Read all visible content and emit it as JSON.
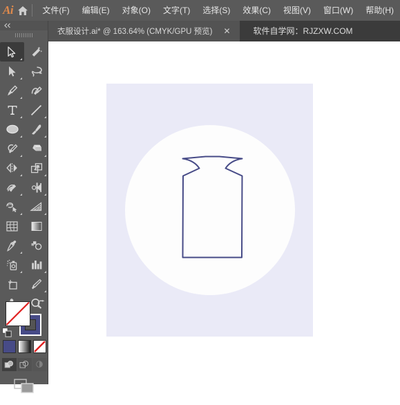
{
  "app": {
    "name": "Adobe Illustrator",
    "logo_text": "Ai",
    "logo_color": "#e08a4c",
    "home_icon": "home-icon"
  },
  "menubar": {
    "items": [
      {
        "label": "文件(F)",
        "name": "menu-file"
      },
      {
        "label": "编辑(E)",
        "name": "menu-edit"
      },
      {
        "label": "对象(O)",
        "name": "menu-object"
      },
      {
        "label": "文字(T)",
        "name": "menu-type"
      },
      {
        "label": "选择(S)",
        "name": "menu-select"
      },
      {
        "label": "效果(C)",
        "name": "menu-effect"
      },
      {
        "label": "视图(V)",
        "name": "menu-view"
      },
      {
        "label": "窗口(W)",
        "name": "menu-window"
      },
      {
        "label": "帮助(H)",
        "name": "menu-help"
      }
    ]
  },
  "tabbar": {
    "document_tab": {
      "label": "衣服设计.ai* @ 163.64% (CMYK/GPU 预览)",
      "filename": "衣服设计.ai",
      "modified": true,
      "zoom": "163.64%",
      "color_mode": "CMYK",
      "preview_mode": "GPU 预览",
      "close_icon": "close-icon",
      "close_label": "✕"
    },
    "promo_text": "软件自学网：RJZXW.COM"
  },
  "toolbar": {
    "collapse_label": "◂◂",
    "tools": [
      {
        "name": "selection-tool",
        "label": "选择工具",
        "active": true,
        "flyout": true
      },
      {
        "name": "magic-wand-tool",
        "label": "魔棒工具",
        "active": false,
        "flyout": false
      },
      {
        "name": "direct-selection-tool",
        "label": "直接选择工具",
        "active": false,
        "flyout": true
      },
      {
        "name": "lasso-tool",
        "label": "套索工具",
        "active": false,
        "flyout": false
      },
      {
        "name": "pen-tool",
        "label": "钢笔工具",
        "active": false,
        "flyout": true
      },
      {
        "name": "curvature-tool",
        "label": "曲率工具",
        "active": false,
        "flyout": false
      },
      {
        "name": "type-tool",
        "label": "文字工具",
        "active": false,
        "flyout": true
      },
      {
        "name": "line-segment-tool",
        "label": "直线段工具",
        "active": false,
        "flyout": true
      },
      {
        "name": "ellipse-tool",
        "label": "椭圆工具",
        "active": false,
        "flyout": true
      },
      {
        "name": "paintbrush-tool",
        "label": "画笔工具",
        "active": false,
        "flyout": true
      },
      {
        "name": "shaper-tool",
        "label": "Shaper 工具",
        "active": false,
        "flyout": true
      },
      {
        "name": "eraser-tool",
        "label": "橡皮擦工具",
        "active": false,
        "flyout": true
      },
      {
        "name": "reflect-tool",
        "label": "镜像工具",
        "active": false,
        "flyout": true
      },
      {
        "name": "scale-tool",
        "label": "比例缩放工具",
        "active": false,
        "flyout": true
      },
      {
        "name": "width-tool",
        "label": "宽度工具",
        "active": false,
        "flyout": true
      },
      {
        "name": "free-transform-tool",
        "label": "自由变换工具",
        "active": false,
        "flyout": false
      },
      {
        "name": "shape-builder-tool",
        "label": "形状生成器工具",
        "active": false,
        "flyout": true
      },
      {
        "name": "perspective-grid-tool",
        "label": "透视网格工具",
        "active": false,
        "flyout": true
      },
      {
        "name": "mesh-tool",
        "label": "网格工具",
        "active": false,
        "flyout": false
      },
      {
        "name": "gradient-tool",
        "label": "渐变工具",
        "active": false,
        "flyout": false
      },
      {
        "name": "eyedropper-tool",
        "label": "吸管工具",
        "active": false,
        "flyout": true
      },
      {
        "name": "blend-tool",
        "label": "混合工具",
        "active": false,
        "flyout": false
      },
      {
        "name": "symbol-sprayer-tool",
        "label": "符号喷枪工具",
        "active": false,
        "flyout": true
      },
      {
        "name": "column-graph-tool",
        "label": "柱形图工具",
        "active": false,
        "flyout": true
      },
      {
        "name": "artboard-tool",
        "label": "画板工具",
        "active": false,
        "flyout": false
      },
      {
        "name": "slice-tool",
        "label": "切片工具",
        "active": false,
        "flyout": true
      },
      {
        "name": "hand-tool",
        "label": "抓手工具",
        "active": false,
        "flyout": true
      },
      {
        "name": "zoom-tool",
        "label": "缩放工具",
        "active": false,
        "flyout": false
      }
    ],
    "color_controls": {
      "fill_label": "填色",
      "fill_color": "none",
      "stroke_label": "描边",
      "stroke_color": "#474b87",
      "swap_icon": "swap-fill-stroke-icon",
      "default_icon": "default-fill-stroke-icon",
      "modes": [
        {
          "name": "color-mode-button",
          "label": "颜色",
          "color": "#474b87",
          "selected": false
        },
        {
          "name": "gradient-mode-button",
          "label": "渐变",
          "selected": false
        },
        {
          "name": "none-mode-button",
          "label": "无",
          "selected": false
        }
      ],
      "draw_modes": [
        {
          "name": "draw-normal-button",
          "label": "正常绘图",
          "selected": true
        },
        {
          "name": "draw-behind-button",
          "label": "背面绘图",
          "selected": false
        },
        {
          "name": "draw-inside-button",
          "label": "内部绘图",
          "selected": false
        }
      ],
      "screen_mode": {
        "name": "change-screen-mode-button",
        "label": "更改屏幕模式"
      }
    }
  },
  "canvas": {
    "background": "#ffffff",
    "artboard": {
      "name": "artboard",
      "background_color": "#eaeaf7",
      "circle_color": "#fdfdfd",
      "zoom_percent": "163.64%"
    },
    "artwork": {
      "name": "garment-bodice-path",
      "description": "衣服设计 - 上衣前片轮廓",
      "stroke_color": "#474b87",
      "fill_color": "none",
      "stroke_width": 2
    }
  }
}
